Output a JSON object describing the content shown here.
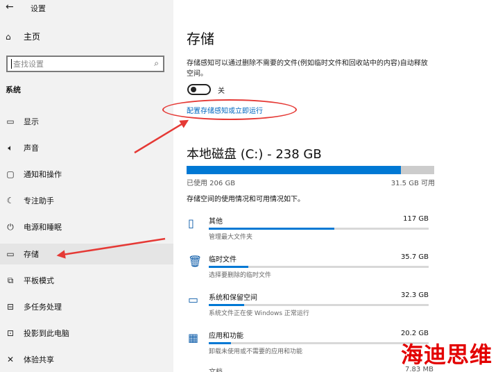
{
  "window": {
    "back": "←",
    "title": "设置"
  },
  "sidebar": {
    "home": {
      "icon": "home-icon",
      "glyph": "⌂",
      "label": "主页"
    },
    "search": {
      "placeholder": "查找设置",
      "icon": "search-icon",
      "glyph": "⌕"
    },
    "section_title": "系统",
    "items": [
      {
        "label": "显示",
        "icon": "monitor-icon",
        "glyph": "▭"
      },
      {
        "label": "声音",
        "icon": "speaker-icon",
        "glyph": "🔈︎"
      },
      {
        "label": "通知和操作",
        "icon": "notification-icon",
        "glyph": "▢"
      },
      {
        "label": "专注助手",
        "icon": "moon-icon",
        "glyph": "☾"
      },
      {
        "label": "电源和睡眠",
        "icon": "power-icon",
        "glyph": "⏻"
      },
      {
        "label": "存储",
        "icon": "storage-icon",
        "glyph": "▭"
      },
      {
        "label": "平板模式",
        "icon": "tablet-icon",
        "glyph": "⧉"
      },
      {
        "label": "多任务处理",
        "icon": "multitask-icon",
        "glyph": "⊟"
      },
      {
        "label": "投影到此电脑",
        "icon": "project-icon",
        "glyph": "⊡"
      },
      {
        "label": "体验共享",
        "icon": "share-icon",
        "glyph": "✕"
      }
    ]
  },
  "main": {
    "title": "存储",
    "description": "存储感知可以通过删除不需要的文件(例如临时文件和回收站中的内容)自动释放空间。",
    "toggle_label": "关",
    "toggle_on": false,
    "link": "配置存储感知或立即运行",
    "disk": {
      "title": "本地磁盘 (C:) - 238 GB",
      "used": "已使用 206 GB",
      "available": "31.5 GB 可用",
      "used_fraction": 0.865
    },
    "usage_desc": "存储空间的使用情况和可用情况如下。",
    "categories": [
      {
        "name": "其他",
        "size": "117 GB",
        "desc": "管理最大文件夹",
        "icon": "folder-icon",
        "glyph": "▯",
        "fraction": 0.57
      },
      {
        "name": "临时文件",
        "size": "35.7 GB",
        "desc": "选择要删除的临时文件",
        "icon": "trash-icon",
        "glyph": "🗑︎",
        "fraction": 0.18
      },
      {
        "name": "系统和保留空间",
        "size": "32.3 GB",
        "desc": "系统文件正在使 Windows 正常运行",
        "icon": "laptop-icon",
        "glyph": "▭",
        "fraction": 0.16
      },
      {
        "name": "应用和功能",
        "size": "20.2 GB",
        "desc": "卸载未使用或不需要的应用和功能",
        "icon": "apps-icon",
        "glyph": "▦",
        "fraction": 0.1
      }
    ],
    "next_peek": {
      "name": "文档",
      "size": "7.83 MB"
    }
  },
  "annotation": {
    "color": "#e53935"
  },
  "watermark": "海迪思维"
}
